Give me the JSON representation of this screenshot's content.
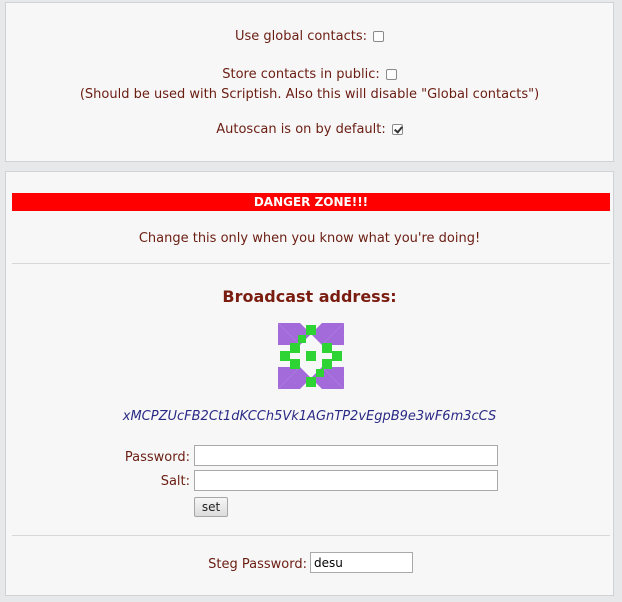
{
  "options": {
    "global_contacts_label": "Use global contacts:",
    "global_contacts_checked": false,
    "store_public_label": "Store contacts in public:",
    "store_public_checked": false,
    "store_public_note": "(Should be used with Scriptish. Also this will disable \"Global contacts\")",
    "autoscan_label": "Autoscan is on by default:",
    "autoscan_checked": true
  },
  "danger": {
    "banner": "DANGER ZONE!!!",
    "warning": "Change this only when you know what you're doing!"
  },
  "broadcast": {
    "title": "Broadcast address:",
    "identicon_colors": {
      "purple": "#a36ad9",
      "green": "#2ed334"
    },
    "address": "xMCPZUcFB2Ct1dKCCh5Vk1AGnTP2vEgpB9e3wF6m3cCS",
    "password_label": "Password:",
    "password_value": "",
    "salt_label": "Salt:",
    "salt_value": "",
    "set_button": "set"
  },
  "steg": {
    "password_label": "Steg Password:",
    "password_value": "desu"
  }
}
